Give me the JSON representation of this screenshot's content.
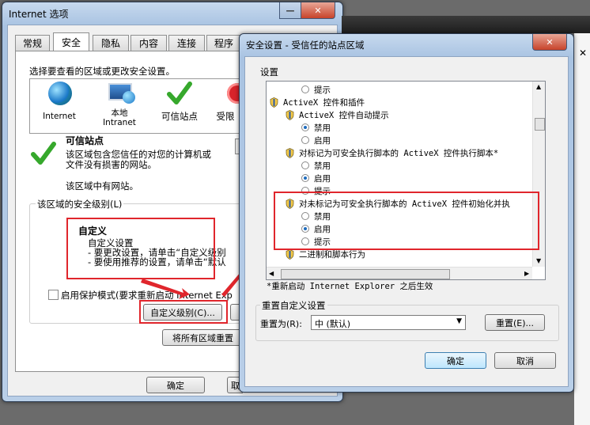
{
  "main_window": {
    "title": "Internet 选项",
    "tabs": [
      "常规",
      "安全",
      "隐私",
      "内容",
      "连接",
      "程序"
    ],
    "active_tab": "安全",
    "zone_prompt": "选择要查看的区域或更改安全设置。",
    "zones": [
      {
        "label": "Internet",
        "icon": "globe-icon"
      },
      {
        "label": "本地\nIntranet",
        "icon": "intranet-icon"
      },
      {
        "label": "可信站点",
        "icon": "checkmark-icon"
      },
      {
        "label": "受限",
        "icon": "restricted-icon"
      }
    ],
    "selected_zone_title": "可信站点",
    "selected_zone_desc": "该区域包含您信任的对您的计算机或\n文件没有损害的网站。",
    "zone_has_sites": "该区域中有网站。",
    "security_level_group": "该区域的安全级别(L)",
    "custom_title": "自定义",
    "custom_lines": [
      "自定义设置",
      "- 要更改设置，请单击“自定义级别",
      "- 要使用推荐的设置，请单击“默认"
    ],
    "protected_mode": "启用保护模式(要求重新启动 Internet Exp",
    "custom_level_button": "自定义级别(C)...",
    "reset_all_button": "将所有区域重置",
    "ok": "确定",
    "cancel": "取"
  },
  "dialog": {
    "title": "安全设置 - 受信任的站点区域",
    "settings_label": "设置",
    "items": [
      {
        "kind": "radio",
        "indent": 2,
        "label": "提示",
        "checked": false
      },
      {
        "kind": "group",
        "indent": 0,
        "label": "ActiveX 控件和插件"
      },
      {
        "kind": "setting",
        "indent": 1,
        "label": "ActiveX 控件自动提示"
      },
      {
        "kind": "radio",
        "indent": 2,
        "label": "禁用",
        "checked": true
      },
      {
        "kind": "radio",
        "indent": 2,
        "label": "启用",
        "checked": false
      },
      {
        "kind": "setting",
        "indent": 1,
        "label": "对标记为可安全执行脚本的 ActiveX 控件执行脚本*"
      },
      {
        "kind": "radio",
        "indent": 2,
        "label": "禁用",
        "checked": false
      },
      {
        "kind": "radio",
        "indent": 2,
        "label": "启用",
        "checked": true
      },
      {
        "kind": "radio",
        "indent": 2,
        "label": "提示",
        "checked": false
      },
      {
        "kind": "setting",
        "indent": 1,
        "label": "对未标记为可安全执行脚本的 ActiveX 控件初始化并执"
      },
      {
        "kind": "radio",
        "indent": 2,
        "label": "禁用",
        "checked": false
      },
      {
        "kind": "radio",
        "indent": 2,
        "label": "启用",
        "checked": true
      },
      {
        "kind": "radio",
        "indent": 2,
        "label": "提示",
        "checked": false
      },
      {
        "kind": "setting",
        "indent": 1,
        "label": "二进制和脚本行为"
      }
    ],
    "restart_note": "*重新启动 Internet Explorer 之后生效",
    "reset_group": "重置自定义设置",
    "reset_to_label": "重置为(R):",
    "reset_to_value": "中 (默认)",
    "reset_button": "重置(E)...",
    "ok": "确定",
    "cancel": "取消"
  },
  "colors": {
    "highlight_red": "#e0262c",
    "title_bar": "#b9cfe8"
  }
}
